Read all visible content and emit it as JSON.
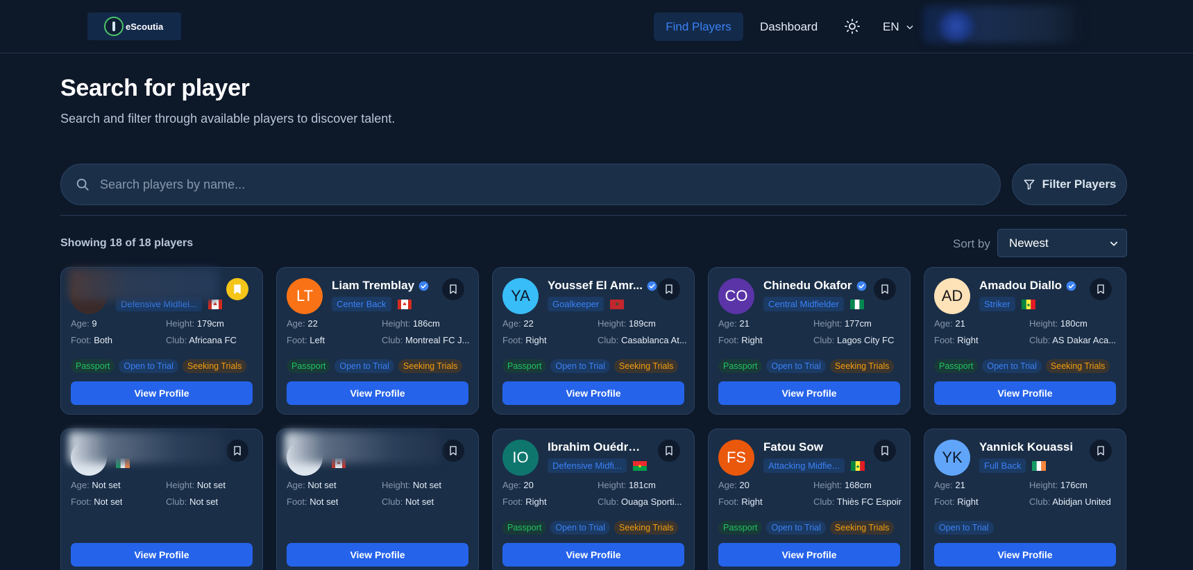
{
  "nav": {
    "logo_text": "eScoutia",
    "find_players": "Find Players",
    "dashboard": "Dashboard",
    "lang": "EN"
  },
  "header": {
    "title": "Search for player",
    "subtitle": "Search and filter through available players to discover talent."
  },
  "search": {
    "placeholder": "Search players by name...",
    "filter_label": "Filter Players"
  },
  "results": {
    "showing": "Showing 18 of 18 players",
    "sort_label": "Sort by",
    "sort_value": "Newest"
  },
  "labels": {
    "age": "Age:",
    "height": "Height:",
    "foot": "Foot:",
    "club": "Club:",
    "view_profile": "View Profile"
  },
  "colors": {
    "accent": "#2563eb",
    "background": "#0d1829",
    "card": "#1a2e47",
    "passport": "#22c55e",
    "seeking": "#f59e0b"
  },
  "players": [
    {
      "initials": "",
      "name": "",
      "position": "Defensive Midfiel...",
      "flag": "canada",
      "age": "9",
      "height": "179cm",
      "foot": "Both",
      "club": "Africana FC",
      "tags": [
        "Passport",
        "Open to Trial",
        "Seeking Trials"
      ],
      "saved": true,
      "verified": false,
      "avatar_color": "#3b2a2a",
      "blurred": true
    },
    {
      "initials": "LT",
      "name": "Liam Tremblay",
      "position": "Center Back",
      "flag": "canada",
      "age": "22",
      "height": "186cm",
      "foot": "Left",
      "club": "Montreal FC J...",
      "tags": [
        "Passport",
        "Open to Trial",
        "Seeking Trials"
      ],
      "saved": false,
      "verified": true,
      "avatar_color": "#f97316"
    },
    {
      "initials": "YA",
      "name": "Youssef El Amr...",
      "position": "Goalkeeper",
      "flag": "morocco",
      "age": "22",
      "height": "189cm",
      "foot": "Right",
      "club": "Casablanca At...",
      "tags": [
        "Passport",
        "Open to Trial",
        "Seeking Trials"
      ],
      "saved": false,
      "verified": true,
      "avatar_color": "#38bdf8",
      "initials_color": "#0d1829"
    },
    {
      "initials": "CO",
      "name": "Chinedu Okafor",
      "position": "Central Midfielder",
      "flag": "nigeria",
      "age": "21",
      "height": "177cm",
      "foot": "Right",
      "club": "Lagos City FC",
      "tags": [
        "Passport",
        "Open to Trial",
        "Seeking Trials"
      ],
      "saved": false,
      "verified": true,
      "avatar_color": "#5b34a8"
    },
    {
      "initials": "AD",
      "name": "Amadou Diallo",
      "position": "Striker",
      "flag": "senegal",
      "age": "21",
      "height": "180cm",
      "foot": "Right",
      "club": "AS Dakar Aca...",
      "tags": [
        "Passport",
        "Open to Trial",
        "Seeking Trials"
      ],
      "saved": false,
      "verified": true,
      "avatar_color": "#fde2b8",
      "initials_color": "#1a1a1a"
    },
    {
      "initials": "",
      "name": "",
      "position": "",
      "flag": "ireland",
      "age": "Not set",
      "height": "Not set",
      "foot": "Not set",
      "club": "Not set",
      "tags": [],
      "saved": false,
      "verified": false,
      "avatar_color": "#dfe6ee",
      "blurred": true
    },
    {
      "initials": "",
      "name": "",
      "position": "",
      "flag": "canada",
      "age": "Not set",
      "height": "Not set",
      "foot": "Not set",
      "club": "Not set",
      "tags": [],
      "saved": false,
      "verified": true,
      "avatar_color": "#dfe6ee",
      "blurred": true
    },
    {
      "initials": "IO",
      "name": "Ibrahim Ouédraogo",
      "position": "Defensive Midfi...",
      "flag": "burkina",
      "age": "20",
      "height": "181cm",
      "foot": "Right",
      "club": "Ouaga Sporti...",
      "tags": [
        "Passport",
        "Open to Trial",
        "Seeking Trials"
      ],
      "saved": false,
      "verified": false,
      "avatar_color": "#0f766e"
    },
    {
      "initials": "FS",
      "name": "Fatou Sow",
      "position": "Attacking Midfie...",
      "flag": "senegal",
      "age": "20",
      "height": "168cm",
      "foot": "Right",
      "club": "Thiès FC Espoir",
      "tags": [
        "Passport",
        "Open to Trial",
        "Seeking Trials"
      ],
      "saved": false,
      "verified": false,
      "avatar_color": "#ea580c"
    },
    {
      "initials": "YK",
      "name": "Yannick Kouassi",
      "position": "Full Back",
      "flag": "ireland",
      "age": "21",
      "height": "176cm",
      "foot": "Right",
      "club": "Abidjan United",
      "tags": [
        "Open to Trial"
      ],
      "saved": false,
      "verified": false,
      "avatar_color": "#60a5fa",
      "initials_color": "#0d1829"
    }
  ]
}
